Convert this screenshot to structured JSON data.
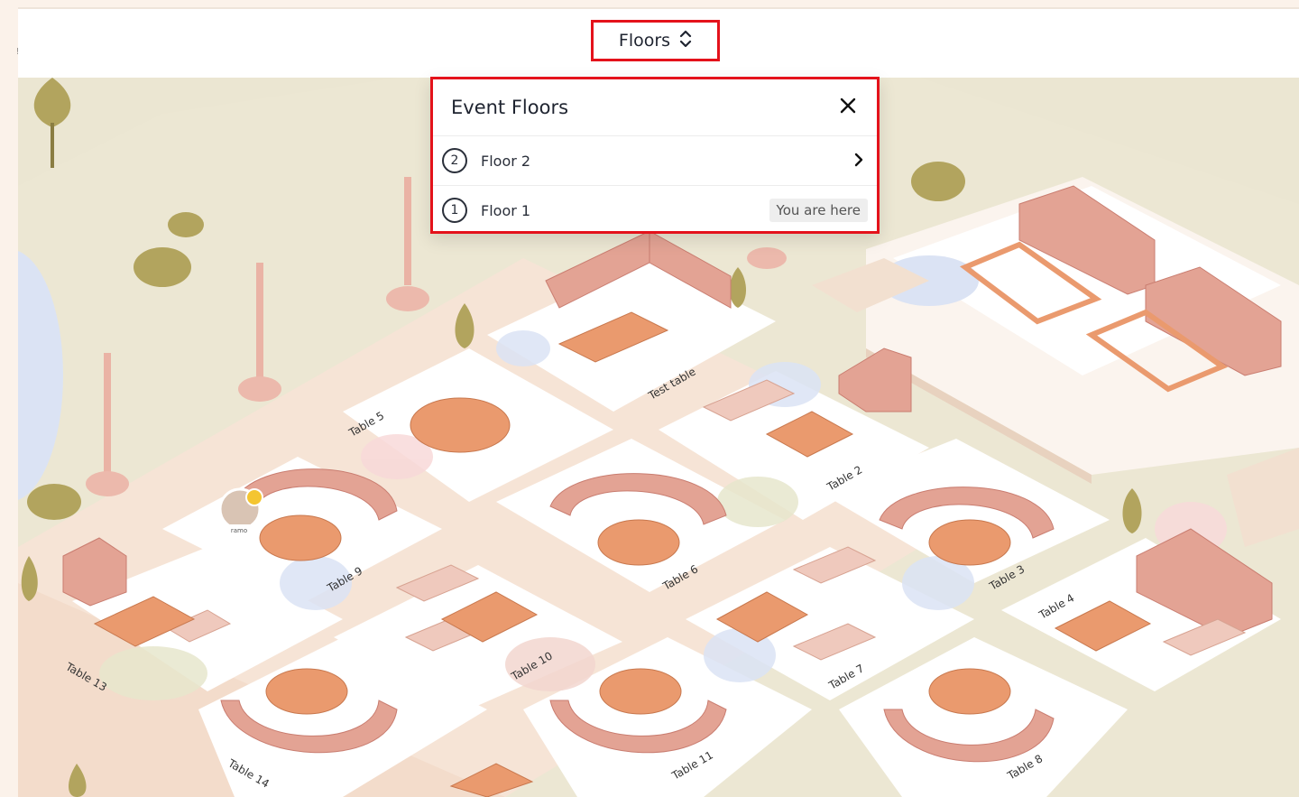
{
  "header": {
    "floors_button_label": "Floors",
    "left_mark": "!"
  },
  "floors_popup": {
    "title": "Event Floors",
    "floors": [
      {
        "number": "2",
        "label": "Floor 2",
        "current": false
      },
      {
        "number": "1",
        "label": "Floor 1",
        "current": true
      }
    ],
    "current_badge": "You are here"
  },
  "map": {
    "avatar_name": "ramo",
    "tables": {
      "test": "Test table",
      "t2": "Table 2",
      "t3": "Table 3",
      "t4": "Table 4",
      "t5": "Table 5",
      "t6": "Table 6",
      "t7": "Table 7",
      "t8": "Table 8",
      "t9": "Table 9",
      "t10": "Table 10",
      "t11": "Table 11",
      "t13": "Table 13",
      "t14": "Table 14"
    }
  },
  "colors": {
    "highlight_border": "#e4121b",
    "ground": "#ebe6d2",
    "floor_tile": "#ffffff",
    "path": "#f6e4d6",
    "sofa": "#e3a394",
    "table_top": "#ea9a6e",
    "plant": "#b2a45e"
  },
  "icons": {
    "floors_toggle": "chevron-up-down-icon",
    "close": "close-icon",
    "next": "chevron-right-icon"
  }
}
